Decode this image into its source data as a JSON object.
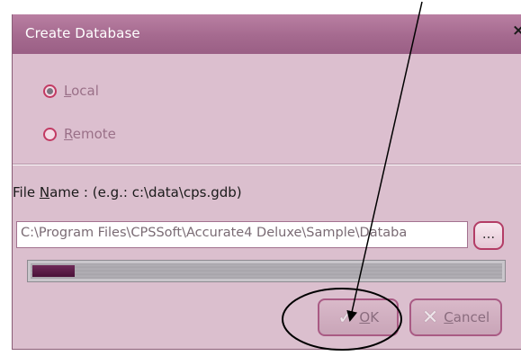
{
  "dialog": {
    "title": "Create Database",
    "close_glyph": "×"
  },
  "location": {
    "options": [
      {
        "label_prefix": "",
        "accel": "L",
        "label_rest": "ocal",
        "checked": true
      },
      {
        "label_prefix": "",
        "accel": "R",
        "label_rest": "emote",
        "checked": false
      }
    ]
  },
  "file": {
    "label_prefix": "File ",
    "label_accel": "N",
    "label_rest": "ame :  (e.g.: c:\\data\\cps.gdb)",
    "value": "C:\\Program Files\\CPSSoft\\Accurate4 Deluxe\\Sample\\Databa",
    "browse_label": "..."
  },
  "progress": {
    "fraction": 0.09
  },
  "buttons": {
    "ok_accel": "O",
    "ok_rest": "K",
    "cancel_accel": "C",
    "cancel_rest": "ancel"
  },
  "icons": {
    "ok": "check-icon",
    "cancel": "cross-icon"
  },
  "colors": {
    "title_bar": "#a56a8f",
    "dialog_bg": "#dcbfcf",
    "radio_ring": "#c23a63",
    "annotation": "#000000"
  }
}
